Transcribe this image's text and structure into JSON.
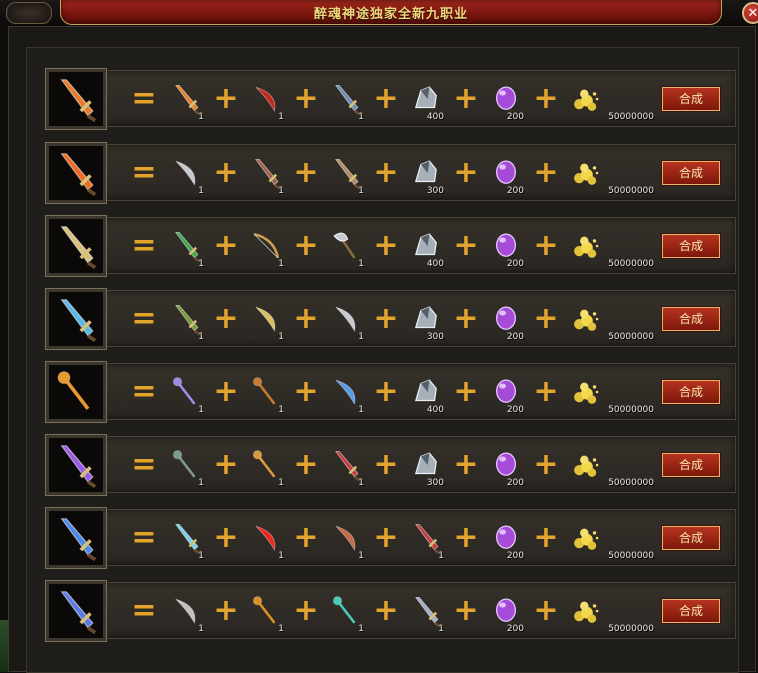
{
  "window": {
    "title": "醉魂神途独家全新九职业",
    "close_icon": "close-icon"
  },
  "colors": {
    "accent_gold": "#e2a42e",
    "button_red": "#b7331f",
    "title_red": "#a3281e"
  },
  "operators": {
    "equals": "=",
    "plus": "+"
  },
  "recipes": [
    {
      "result_icon": "flame-sword-icon",
      "result_color": "#e87a2a",
      "materials": [
        {
          "icon": "flame-sword-icon",
          "color": "#e8802a",
          "count": "1"
        },
        {
          "icon": "red-blade-icon",
          "color": "#c42a20",
          "count": "1"
        },
        {
          "icon": "blue-sword-icon",
          "color": "#6b8fb8",
          "count": "1"
        },
        {
          "icon": "ore-icon",
          "color": "#a7b0b8",
          "count": "400"
        },
        {
          "icon": "purple-gem-icon",
          "color": "#a54bd8",
          "count": "200"
        },
        {
          "icon": "gold-coins-icon",
          "color": "#e2c23a",
          "count": "50000000"
        }
      ],
      "button": "合成"
    },
    {
      "result_icon": "flame-sword-icon",
      "result_color": "#f06a20",
      "materials": [
        {
          "icon": "curved-blade-icon",
          "color": "#c8c8d0",
          "count": "1"
        },
        {
          "icon": "dagger-icon",
          "color": "#a0604a",
          "count": "1"
        },
        {
          "icon": "spear-icon",
          "color": "#b08a60",
          "count": "1"
        },
        {
          "icon": "ore-icon",
          "color": "#a7b0b8",
          "count": "300"
        },
        {
          "icon": "purple-gem-icon",
          "color": "#a54bd8",
          "count": "200"
        },
        {
          "icon": "gold-coins-icon",
          "color": "#e2c23a",
          "count": "50000000"
        }
      ],
      "button": "合成"
    },
    {
      "result_icon": "golden-sword-icon",
      "result_color": "#d8c07a",
      "materials": [
        {
          "icon": "green-blade-icon",
          "color": "#3ea84a",
          "count": "1"
        },
        {
          "icon": "bow-icon",
          "color": "#c8a050",
          "count": "1"
        },
        {
          "icon": "axe-icon",
          "color": "#c8ccd2",
          "count": "1"
        },
        {
          "icon": "ore-icon",
          "color": "#a7b0b8",
          "count": "400"
        },
        {
          "icon": "purple-gem-icon",
          "color": "#a54bd8",
          "count": "200"
        },
        {
          "icon": "gold-coins-icon",
          "color": "#e2c23a",
          "count": "50000000"
        }
      ],
      "button": "合成"
    },
    {
      "result_icon": "ice-sword-icon",
      "result_color": "#58b8e8",
      "materials": [
        {
          "icon": "green-blade-icon",
          "color": "#7a9a3a",
          "count": "1"
        },
        {
          "icon": "curved-blade-icon",
          "color": "#d8c060",
          "count": "1"
        },
        {
          "icon": "curved-blade-icon",
          "color": "#c8c8d0",
          "count": "1"
        },
        {
          "icon": "ore-icon",
          "color": "#a7b0b8",
          "count": "300"
        },
        {
          "icon": "purple-gem-icon",
          "color": "#a54bd8",
          "count": "200"
        },
        {
          "icon": "gold-coins-icon",
          "color": "#e2c23a",
          "count": "50000000"
        }
      ],
      "button": "合成"
    },
    {
      "result_icon": "scepter-icon",
      "result_color": "#e89a30",
      "materials": [
        {
          "icon": "staff-icon",
          "color": "#a08ae8",
          "count": "1"
        },
        {
          "icon": "staff-icon",
          "color": "#c87a30",
          "count": "1"
        },
        {
          "icon": "curved-blade-icon",
          "color": "#5a9ae8",
          "count": "1"
        },
        {
          "icon": "ore-icon",
          "color": "#a7b0b8",
          "count": "400"
        },
        {
          "icon": "purple-gem-icon",
          "color": "#a54bd8",
          "count": "200"
        },
        {
          "icon": "gold-coins-icon",
          "color": "#e2c23a",
          "count": "50000000"
        }
      ],
      "button": "合成"
    },
    {
      "result_icon": "violet-sword-icon",
      "result_color": "#9a5ae8",
      "materials": [
        {
          "icon": "staff-icon",
          "color": "#7a9a8a",
          "count": "1"
        },
        {
          "icon": "staff-icon",
          "color": "#d89a40",
          "count": "1"
        },
        {
          "icon": "dagger-icon",
          "color": "#c83a3a",
          "count": "1"
        },
        {
          "icon": "ore-icon",
          "color": "#a7b0b8",
          "count": "300"
        },
        {
          "icon": "purple-gem-icon",
          "color": "#a54bd8",
          "count": "200"
        },
        {
          "icon": "gold-coins-icon",
          "color": "#e2c23a",
          "count": "50000000"
        }
      ],
      "button": "合成"
    },
    {
      "result_icon": "ice-sword-icon",
      "result_color": "#4a8ae8",
      "materials": [
        {
          "icon": "blue-sword-icon",
          "color": "#7ad0e8",
          "count": "1"
        },
        {
          "icon": "red-blade-icon",
          "color": "#e82a20",
          "count": "1"
        },
        {
          "icon": "curved-blade-icon",
          "color": "#c86a4a",
          "count": "1"
        },
        {
          "icon": "spear-icon",
          "color": "#c83a3a",
          "count": "1"
        },
        {
          "icon": "purple-gem-icon",
          "color": "#a54bd8",
          "count": "200"
        },
        {
          "icon": "gold-coins-icon",
          "color": "#e2c23a",
          "count": "50000000"
        }
      ],
      "button": "合成"
    },
    {
      "result_icon": "ice-sword-icon",
      "result_color": "#5a7ae8",
      "materials": [
        {
          "icon": "curved-blade-icon",
          "color": "#c0c0c0",
          "count": "1"
        },
        {
          "icon": "scepter-icon",
          "color": "#d8902a",
          "count": "1"
        },
        {
          "icon": "staff-icon",
          "color": "#4ac8b8",
          "count": "1"
        },
        {
          "icon": "blue-sword-icon",
          "color": "#a0b0c8",
          "count": "1"
        },
        {
          "icon": "purple-gem-icon",
          "color": "#a54bd8",
          "count": "200"
        },
        {
          "icon": "gold-coins-icon",
          "color": "#e2c23a",
          "count": "50000000"
        }
      ],
      "button": "合成"
    }
  ]
}
